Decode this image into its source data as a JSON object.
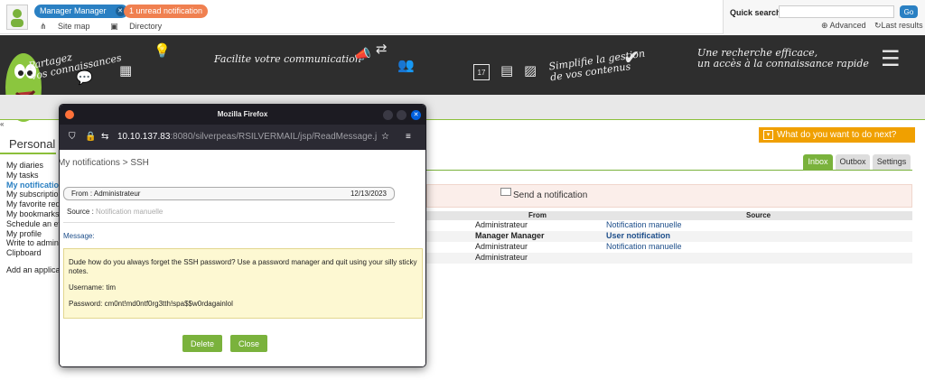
{
  "topbar": {
    "user_name": "Manager Manager",
    "notifications": "1 unread notification",
    "site_map": "Site map",
    "directory": "Directory"
  },
  "quick_search": {
    "label": "Quick search",
    "placeholder": "",
    "go": "Go",
    "advanced": "Advanced",
    "last_results": "Last results"
  },
  "banner": {
    "t1": "Partagez\nvos connaissances",
    "t2": "Facilite votre communication",
    "t3": "Simplifie la gestion\nde vos contenus",
    "t4": "Une recherche efficace,\nun accès à la connaissance rapide",
    "calendar_day": "17"
  },
  "sidebar": {
    "title": "Personal w",
    "items": [
      {
        "label": "My diaries"
      },
      {
        "label": "My tasks"
      },
      {
        "label": "My notification",
        "active": true
      },
      {
        "label": "My subscription"
      },
      {
        "label": "My favorite requ"
      },
      {
        "label": "My bookmarks"
      },
      {
        "label": "Schedule an eve"
      },
      {
        "label": "My profile"
      },
      {
        "label": "Write to adminis"
      },
      {
        "label": "Clipboard"
      }
    ],
    "add_app": "Add an applicati"
  },
  "main": {
    "what_todo": "What do you want to do next?",
    "tabs": [
      "Inbox",
      "Outbox",
      "Settings"
    ],
    "send_notification": "Send a notification",
    "table": {
      "headers": [
        "From",
        "Source"
      ],
      "rows": [
        {
          "from": "Administrateur",
          "source": "Notification manuelle",
          "bold": false
        },
        {
          "from": "Manager Manager",
          "source": "User notification",
          "bold": true
        },
        {
          "from": "Administrateur",
          "source": "Notification manuelle",
          "bold": false
        },
        {
          "from": "Administrateur",
          "source": "",
          "bold": false
        }
      ]
    }
  },
  "popup": {
    "window_title": "Mozilla Firefox",
    "url_host": "10.10.137.83",
    "url_path": ":8080/silverpeas/RSILVERMAIL/jsp/ReadMessage.j",
    "breadcrumb": "My notifications > SSH",
    "from_label": "From : Administrateur",
    "date": "12/13/2023",
    "source_label": "Source :",
    "source_value": "Notification manuelle",
    "message_label": "Message:",
    "message_lines": [
      "Dude how do you always forget the SSH password? Use a password manager and quit using your silly sticky notes.",
      "Username: tim",
      "Password: cm0nt!md0ntf0rg3tth!spa$$w0rdagainlol"
    ],
    "delete": "Delete",
    "close": "Close"
  },
  "icons": {
    "nav_back": "double-chevron-left-icon"
  }
}
